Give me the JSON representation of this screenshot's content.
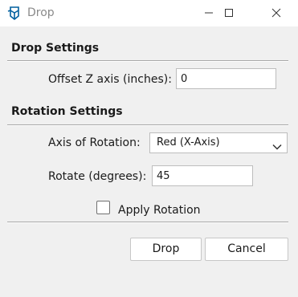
{
  "window": {
    "title": "Drop",
    "icon": "sketchup-logo-icon",
    "controls": {
      "minimize_icon": "minimize-icon",
      "maximize_icon": "maximize-icon",
      "close_icon": "close-icon"
    }
  },
  "drop_settings": {
    "heading": "Drop Settings",
    "offset_label": "Offset Z axis (inches):",
    "offset_value": "0"
  },
  "rotation_settings": {
    "heading": "Rotation Settings",
    "axis_label": "Axis of Rotation:",
    "axis_value": "Red (X-Axis)",
    "rotate_label": "Rotate (degrees):",
    "rotate_value": "45",
    "apply_label": "Apply Rotation",
    "apply_checked": false
  },
  "buttons": {
    "drop_label": "Drop",
    "cancel_label": "Cancel"
  },
  "colors": {
    "brand": "#005f9e",
    "separator": "#a8a8a8",
    "title_text": "#8a8a8a"
  }
}
